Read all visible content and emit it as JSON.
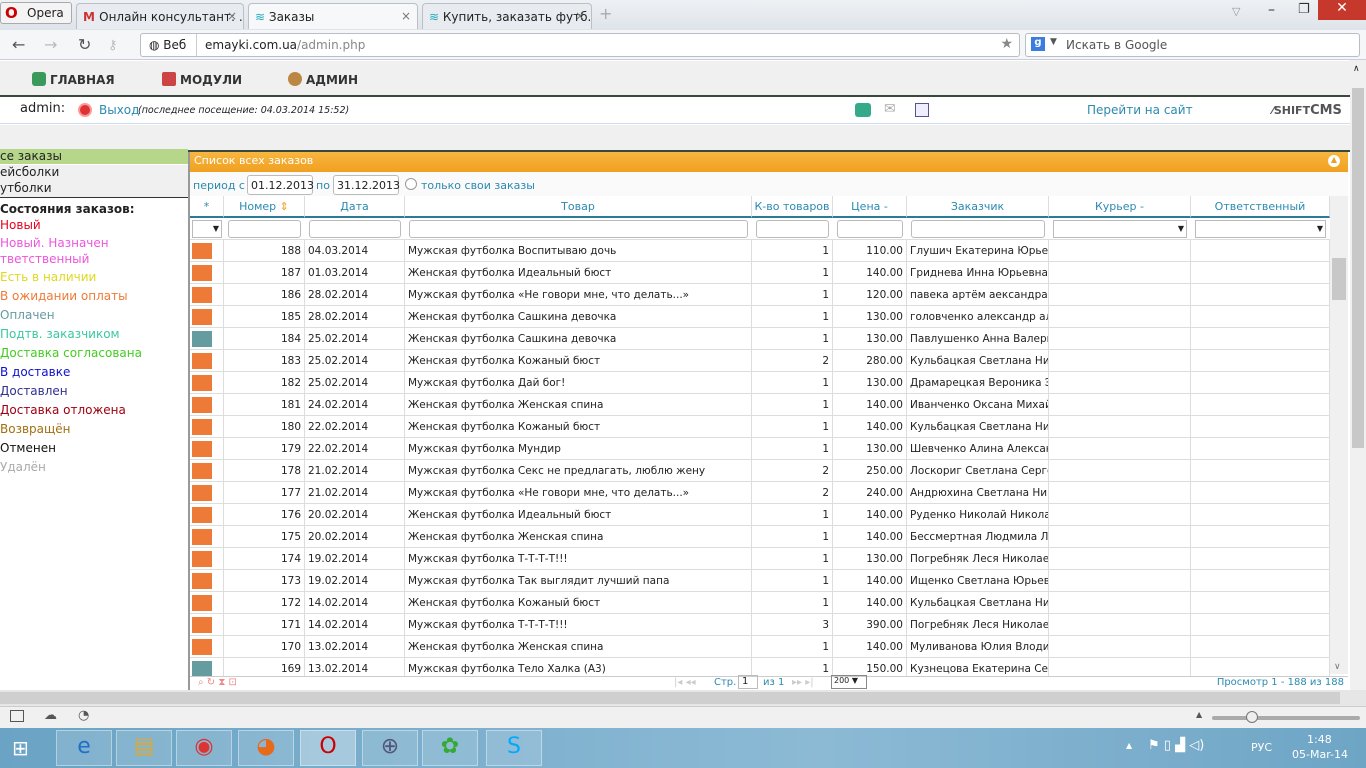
{
  "browser": {
    "opera_label": "Opera",
    "tabs": [
      {
        "label": "Онлайн консультант: ..."
      },
      {
        "label": "Заказы"
      },
      {
        "label": "Купить, заказать футб..."
      }
    ],
    "address_web": "Веб",
    "url_host": "emayki.com.ua",
    "url_path": "/admin.php",
    "search_placeholder": "Искать в Google"
  },
  "menu": {
    "items": [
      "ГЛАВНАЯ",
      "МОДУЛИ",
      "АДМИН"
    ]
  },
  "userbar": {
    "user": "admin:",
    "logout": "Выход",
    "last_visit": "(последнее посещение: 04.03.2014 15:52)",
    "go_to_site": "Перейти на сайт",
    "logo": "SHIFT studio CMS"
  },
  "sidebar": {
    "categories": [
      "се заказы",
      "ейсболки",
      "утболки"
    ],
    "states_title": "Состояния заказов:",
    "states": [
      {
        "label": "Новый",
        "color": "#e8001c"
      },
      {
        "label": "Новый. Назначен",
        "color": "#ee55dd"
      },
      {
        "label": "тветственный",
        "color": "#ee55dd"
      },
      {
        "label": "Есть в наличии",
        "color": "#e0d820"
      },
      {
        "label": "В ожидании оплаты",
        "color": "#ee7a37"
      },
      {
        "label": "Оплачен",
        "color": "#649ca0"
      },
      {
        "label": "Подтв. заказчиком",
        "color": "#3ac8a0"
      },
      {
        "label": "Доставка согласована",
        "color": "#44cc22"
      },
      {
        "label": "В доставке",
        "color": "#1010d0"
      },
      {
        "label": "Доставлен",
        "color": "#303090"
      },
      {
        "label": "Доставка отложена",
        "color": "#a00010"
      },
      {
        "label": "Возвращён",
        "color": "#a07010"
      },
      {
        "label": "Отменен",
        "color": "#111111"
      },
      {
        "label": "Удалён",
        "color": "#aaaaaa"
      }
    ]
  },
  "grid": {
    "title": "Список всех заказов",
    "period_from_label": "период с",
    "period_from": "01.12.2013",
    "period_to_label": "по",
    "period_to": "31.12.2013",
    "own_only_label": "только свои заказы",
    "columns": [
      "*",
      "Номер",
      "Дата",
      "Товар",
      "К-во товаров",
      "Цена -",
      "Заказчик",
      "Курьер -",
      "Ответственный"
    ],
    "rows": [
      [
        "188",
        "04.03.2014",
        "Мужская футболка Воспитываю дочь",
        "1",
        "110.00",
        "Глушич Екатерина Юрьевна",
        "#ee7a37"
      ],
      [
        "187",
        "01.03.2014",
        "Женская футболка Идеальный бюст",
        "1",
        "140.00",
        "Гриднева Инна Юрьевна",
        "#ee7a37"
      ],
      [
        "186",
        "28.02.2014",
        "Мужская футболка «Не говори мне, что делать...»",
        "1",
        "120.00",
        "павека артём аександравич",
        "#ee7a37"
      ],
      [
        "185",
        "28.02.2014",
        "Женская футболка Сашкина девочка",
        "1",
        "130.00",
        "головченко александр алек",
        "#ee7a37"
      ],
      [
        "184",
        "25.02.2014",
        "Женская футболка Сашкина девочка",
        "1",
        "130.00",
        "Павлушенко Анна Валерьевна",
        "#649ca0"
      ],
      [
        "183",
        "25.02.2014",
        "Женская футболка Кожаный бюст",
        "2",
        "280.00",
        "Кульбацкая Светлана  Никол",
        "#ee7a37"
      ],
      [
        "182",
        "25.02.2014",
        "Мужская футболка Дай бог!",
        "1",
        "130.00",
        "Драмарецкая Вероника Эду",
        "#ee7a37"
      ],
      [
        "181",
        "24.02.2014",
        "Женская футболка Женская спина",
        "1",
        "140.00",
        "Иванченко Оксана Михайло",
        "#ee7a37"
      ],
      [
        "180",
        "22.02.2014",
        "Женская футболка Кожаный бюст",
        "1",
        "140.00",
        "Кульбацкая Светлана  Никол",
        "#ee7a37"
      ],
      [
        "179",
        "22.02.2014",
        "Мужская футболка Мундир",
        "1",
        "130.00",
        "Шевченко Алина Александр",
        "#ee7a37"
      ],
      [
        "178",
        "21.02.2014",
        "Мужская футболка Секс не предлагать, люблю жену",
        "2",
        "250.00",
        "Лоскориг Светлана Сергеевна",
        "#ee7a37"
      ],
      [
        "177",
        "21.02.2014",
        "Мужская футболка «Не говори мне, что делать...»",
        "2",
        "240.00",
        "Андрюхина Светлана Никол",
        "#ee7a37"
      ],
      [
        "176",
        "20.02.2014",
        "Женская футболка Идеальный бюст",
        "1",
        "140.00",
        "Руденко Николай Николаевич",
        "#ee7a37"
      ],
      [
        "175",
        "20.02.2014",
        "Женская футболка Женская спина",
        "1",
        "140.00",
        "Бессмертная  Людмила Лео",
        "#ee7a37"
      ],
      [
        "174",
        "19.02.2014",
        "Мужская футболка Т-Т-Т-Т!!!",
        "1",
        "130.00",
        "Погребняк Леся Николаевна",
        "#ee7a37"
      ],
      [
        "173",
        "19.02.2014",
        "Мужская футболка Так выглядит лучший папа",
        "1",
        "140.00",
        "Ищенко Светлана Юрьевна",
        "#ee7a37"
      ],
      [
        "172",
        "14.02.2014",
        "Женская футболка Кожаный бюст",
        "1",
        "140.00",
        "Кульбацкая Светлана  Никол",
        "#ee7a37"
      ],
      [
        "171",
        "14.02.2014",
        "Мужская футболка Т-Т-Т-Т!!!",
        "3",
        "390.00",
        "Погребняк Леся Николаевна",
        "#ee7a37"
      ],
      [
        "170",
        "13.02.2014",
        "Женская футболка Женская спина",
        "1",
        "140.00",
        "Муливанова Юлия Влодимир",
        "#ee7a37"
      ],
      [
        "169",
        "13.02.2014",
        "Мужская футболка Тело Халка (А3)",
        "1",
        "150.00",
        "Кузнецова Екатерина Серге",
        "#649ca0"
      ]
    ],
    "pager": {
      "page_label": "Стр.",
      "page": "1",
      "of_label": "из 1",
      "per_page": "200",
      "view_info": "Просмотр 1 - 188 из 188"
    }
  },
  "taskbar": {
    "lang": "РУС",
    "time": "1:48",
    "date": "05-Mar-14"
  }
}
